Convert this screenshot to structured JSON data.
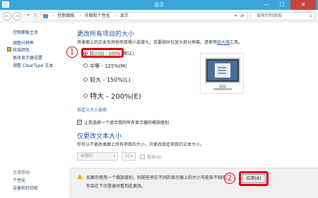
{
  "window": {
    "title": "显示",
    "controls": {
      "minimize": "—",
      "maximize": "☐",
      "close": "✕"
    }
  },
  "addressbar": {
    "breadcrumbs": [
      "控制面板",
      "外观和个性化",
      "显示"
    ],
    "search_placeholder": "搜索控制面板"
  },
  "sidebar": {
    "items": [
      {
        "label": "控制面板主页"
      },
      {
        "label": "调整分辨率"
      },
      {
        "label": "校准颜色"
      },
      {
        "label": "更改显示器设置"
      },
      {
        "label": "调整 ClearType 文本"
      }
    ],
    "see_also": {
      "heading": "另请参阅",
      "items": [
        {
          "label": "个性化"
        },
        {
          "label": "设备和打印机"
        }
      ]
    }
  },
  "main": {
    "heading": "更改所有项目的大小",
    "description": "将桌面上的文本及其他项目缩小或增大。若要临时仅放大部分屏幕，请使用",
    "description_link": "放大镜",
    "description_end": "工具。",
    "options": [
      {
        "label": "较小(S) - 100% (默认)",
        "selected": true
      },
      {
        "label": "中等 - 125%(M)",
        "selected": false
      },
      {
        "label": "较大 - 150%(L)",
        "selected": false
      },
      {
        "label": "特大 - 200%(E)",
        "selected": false
      }
    ],
    "custom_link": "自定义大小选项",
    "checkbox_label": "让我选择一个适合我的所有显示器的缩放级别",
    "checkbox_checked": true,
    "text_heading": "仅更改文本大小",
    "text_description": "你可以不更改桌面上所有项目的大小，只更改指定项目的文本大小。",
    "item_select": "标题栏",
    "size_select": "11",
    "bold_label": "粗体(B)"
  },
  "notice": {
    "line1": "如果你使用一个缩放级别，则某些项在不同的显示器上的大小可能各不相同。",
    "line2": "你会在下次登录时看到此更改。",
    "apply_label": "应用(A)"
  },
  "annotations": {
    "callout1": "1",
    "callout2": "2",
    "color": "#e60012"
  }
}
